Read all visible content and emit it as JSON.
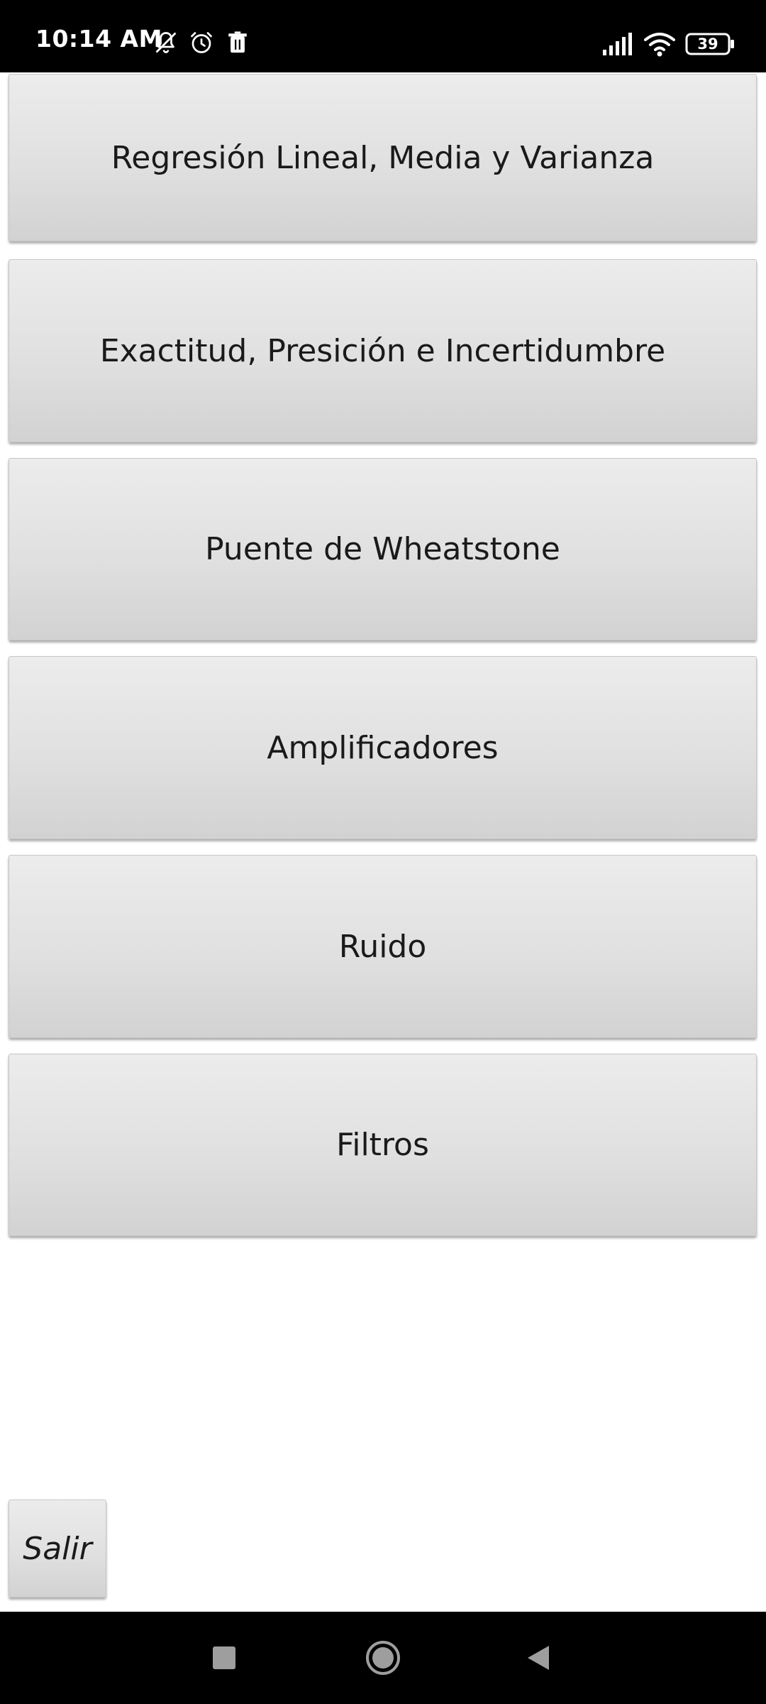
{
  "status_bar": {
    "time": "10:14 AM",
    "battery_level": "39",
    "icons": [
      "mute-bell-icon",
      "alarm-icon",
      "delete-icon",
      "signal-icon",
      "wifi-icon",
      "battery-icon"
    ]
  },
  "menu": {
    "items": [
      {
        "label": "Regresión Lineal, Media y Varianza"
      },
      {
        "label": "Exactitud, Presición e Incertidumbre"
      },
      {
        "label": "Puente de Wheatstone"
      },
      {
        "label": "Amplificadores"
      },
      {
        "label": "Ruido"
      },
      {
        "label": "Filtros"
      }
    ]
  },
  "exit_button": {
    "label": "Salir"
  },
  "nav_bar": {
    "icons": [
      "recents-square-icon",
      "home-circle-icon",
      "back-triangle-icon"
    ]
  },
  "colors": {
    "status_bar_bg": "#000000",
    "button_face": "#e0e0e0",
    "text": "#1a1a1a"
  }
}
